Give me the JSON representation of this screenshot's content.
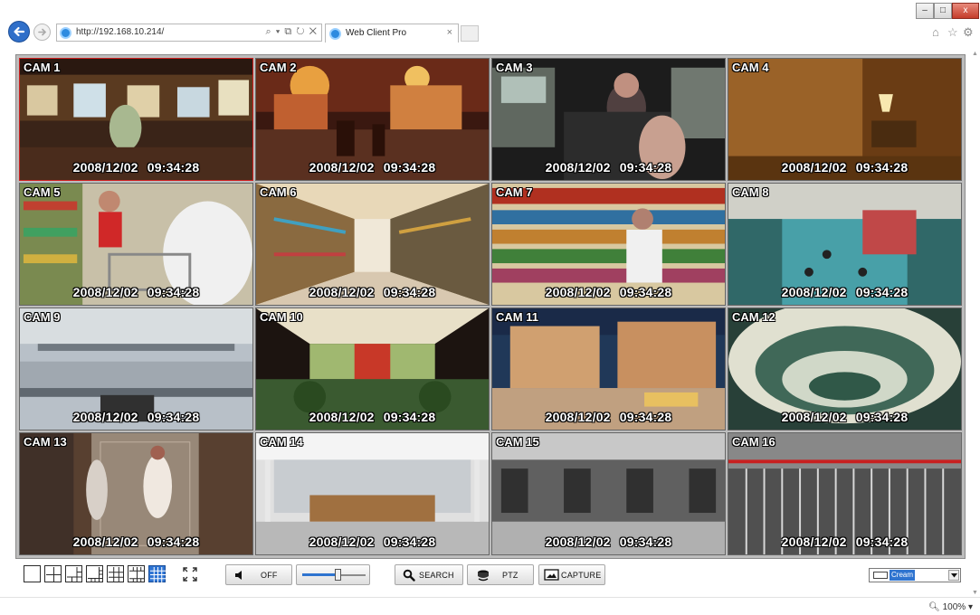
{
  "browser": {
    "address_url": "http://192.168.10.214/",
    "address_tools": "⌕ ▾ ⧉ ↻ ✕",
    "tab_title": "Web Client Pro",
    "tab_close": "×",
    "window_controls": {
      "minimize": "–",
      "maximize": "□",
      "close": "x"
    },
    "nav_icons": [
      "home-icon",
      "star-icon",
      "gear-icon"
    ]
  },
  "cameras": [
    {
      "label": "CAM 1",
      "timestamp": "2008/12/02 09:34:28",
      "selected": true
    },
    {
      "label": "CAM 2",
      "timestamp": "2008/12/02 09:34:28"
    },
    {
      "label": "CAM 3",
      "timestamp": "2008/12/02 09:34:28"
    },
    {
      "label": "CAM 4",
      "timestamp": "2008/12/02 09:34:28"
    },
    {
      "label": "CAM 5",
      "timestamp": "2008/12/02 09:34:28"
    },
    {
      "label": "CAM 6",
      "timestamp": "2008/12/02 09:34:28"
    },
    {
      "label": "CAM 7",
      "timestamp": "2008/12/02 09:34:28"
    },
    {
      "label": "CAM 8",
      "timestamp": "2008/12/02 09:34:28"
    },
    {
      "label": "CAM 9",
      "timestamp": "2008/12/02 09:34:28"
    },
    {
      "label": "CAM 10",
      "timestamp": "2008/12/02 09:34:28"
    },
    {
      "label": "CAM 11",
      "timestamp": "2008/12/02 09:34:28"
    },
    {
      "label": "CAM 12",
      "timestamp": "2008/12/02 09:34:28"
    },
    {
      "label": "CAM 13",
      "timestamp": "2008/12/02 09:34:28"
    },
    {
      "label": "CAM 14",
      "timestamp": "2008/12/02 09:34:28"
    },
    {
      "label": "CAM 15",
      "timestamp": "2008/12/02 09:34:28"
    },
    {
      "label": "CAM 16",
      "timestamp": "2008/12/02 09:34:28"
    }
  ],
  "toolbar": {
    "layouts": [
      {
        "name": "layout-1x1",
        "icon": "single-view-icon"
      },
      {
        "name": "layout-2x2",
        "icon": "quad-view-icon"
      },
      {
        "name": "layout-1plus5",
        "icon": "six-view-icon"
      },
      {
        "name": "layout-1plus7",
        "icon": "eight-view-icon"
      },
      {
        "name": "layout-3x3",
        "icon": "nine-view-icon"
      },
      {
        "name": "layout-2plus8",
        "icon": "ten-view-icon"
      },
      {
        "name": "layout-4x4",
        "icon": "sixteen-view-icon",
        "active": true
      }
    ],
    "audio_label": "OFF",
    "volume_level": 0.55,
    "search_label": "SEARCH",
    "ptz_label": "PTZ",
    "capture_label": "CAPTURE",
    "theme_value": "Cream",
    "accent_color": "#2f74d0"
  },
  "status": {
    "zoom": "100%"
  }
}
